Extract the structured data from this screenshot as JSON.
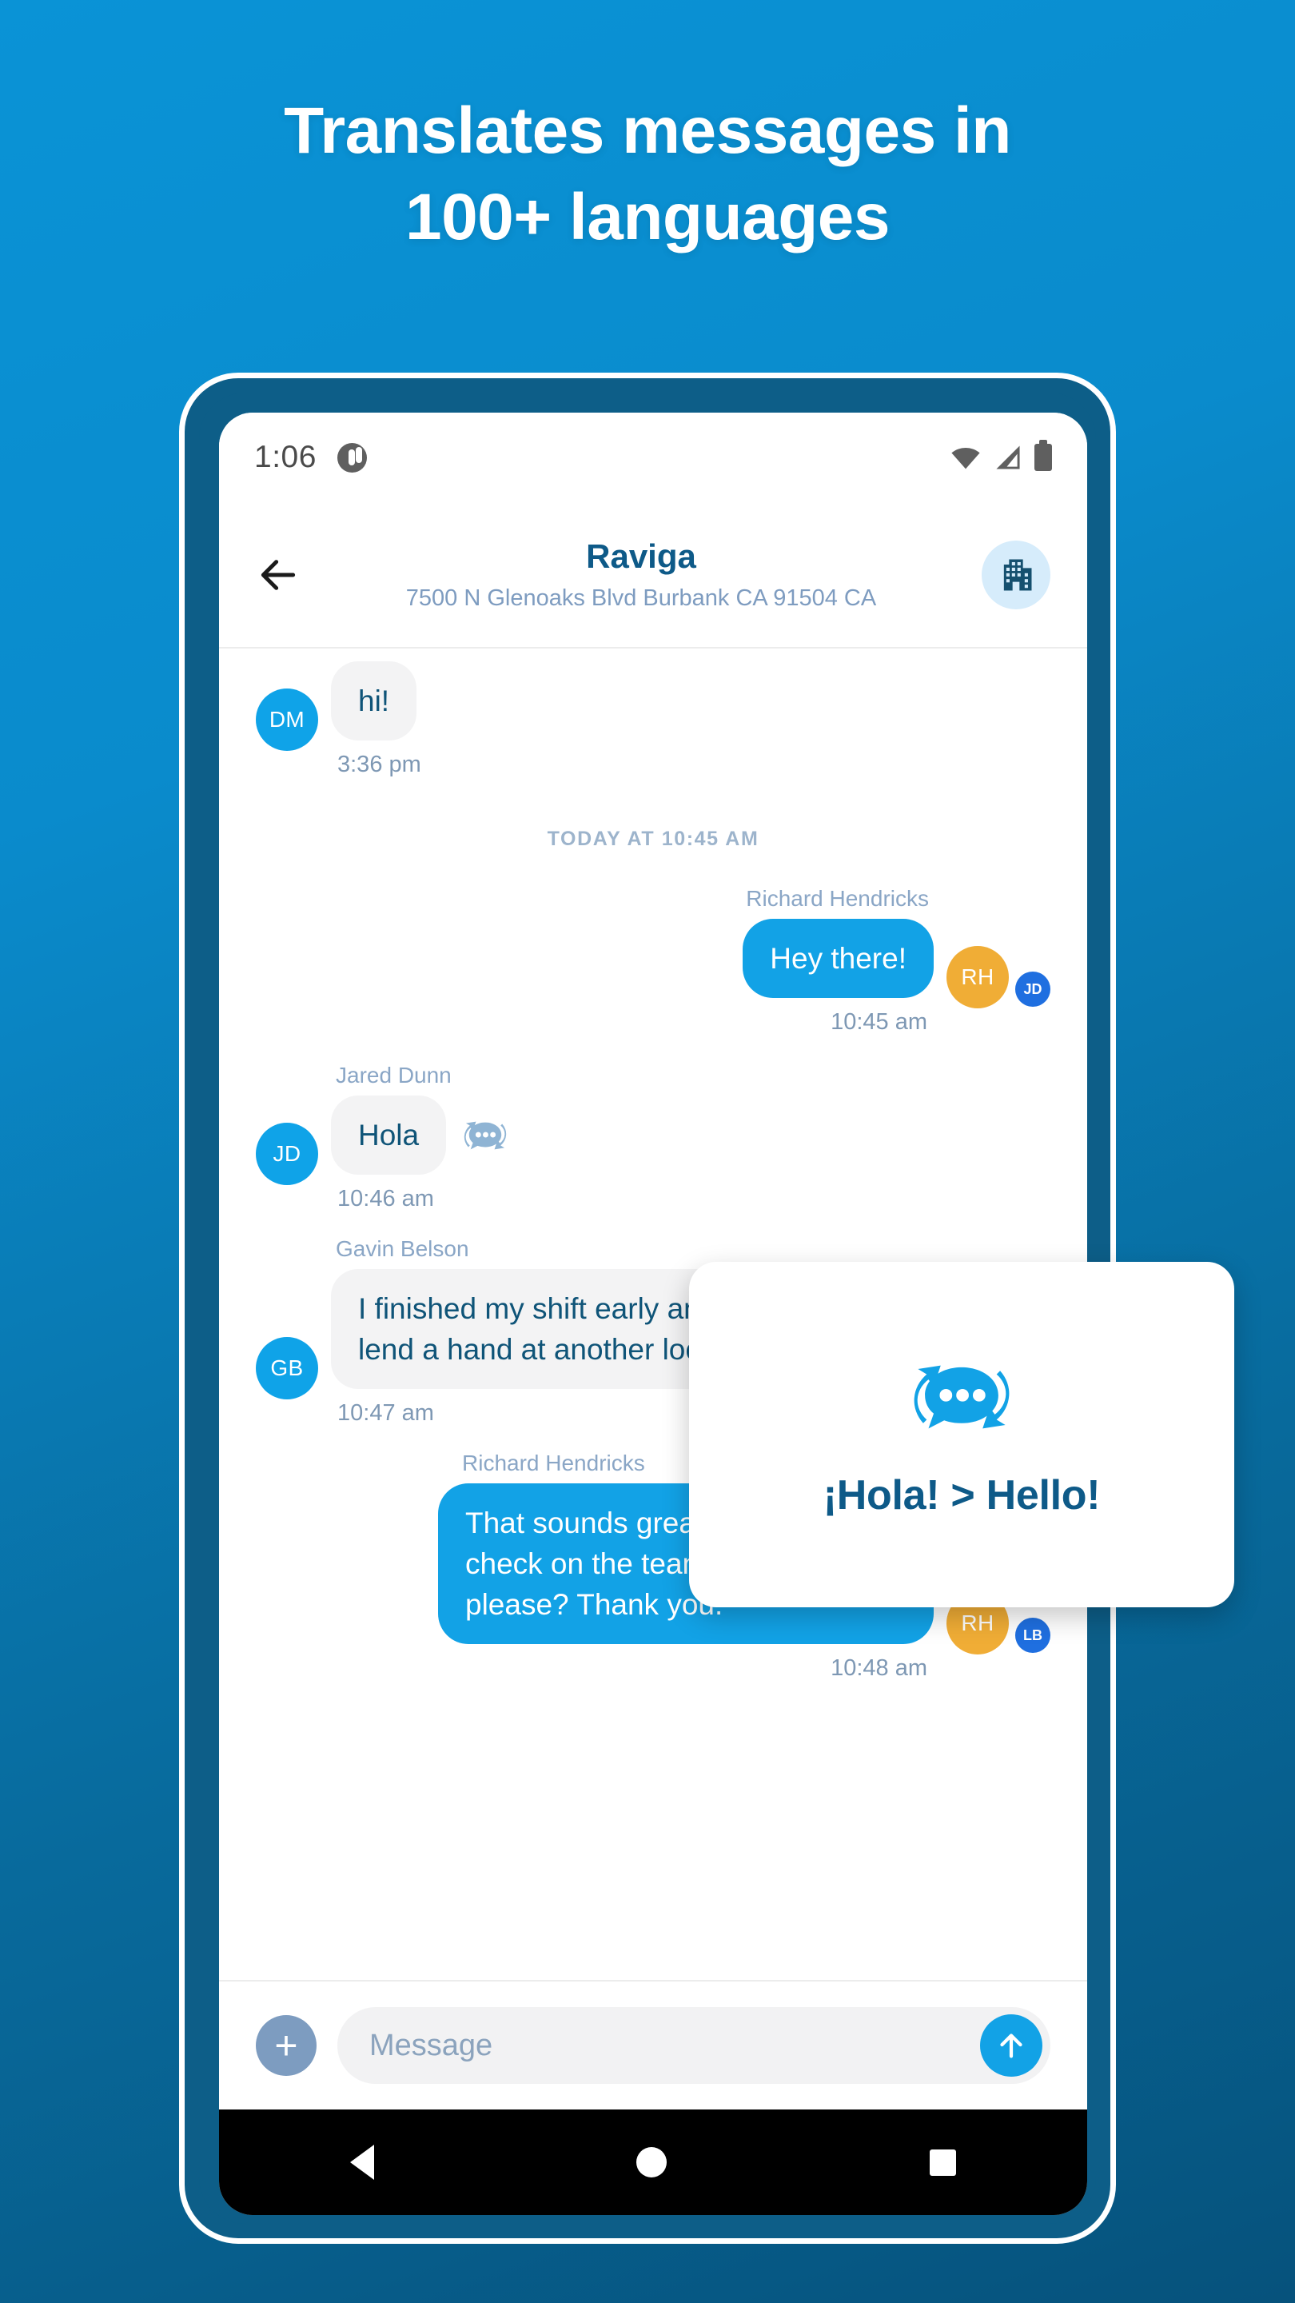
{
  "headline": {
    "line1": "Translates messages in",
    "line2": "100+ languages"
  },
  "colors": {
    "bg_top": "#0a93d6",
    "bg_bottom": "#06527c",
    "accent_blue": "#12a2e6",
    "deep_blue": "#0e5a88",
    "avatar_blue": "#0fa3e8",
    "avatar_orange": "#f0ad36",
    "badge_blue": "#1f6fe0",
    "bubble_in": "#f3f3f4"
  },
  "status_bar": {
    "time": "1:06",
    "notification_icon": "notification-circle-icon",
    "wifi_icon": "wifi-icon",
    "signal_icon": "cell-signal-icon",
    "battery_icon": "battery-full-icon"
  },
  "chat_header": {
    "back_icon": "back-arrow-icon",
    "title": "Raviga",
    "subtitle": "7500 N Glenoaks Blvd Burbank CA 91504 CA",
    "action_icon": "office-building-icon"
  },
  "messages": [
    {
      "side": "left",
      "avatar": "DM",
      "avatar_color": "blue",
      "sender": "",
      "text": "hi!",
      "time": "3:36 pm",
      "translate_icon": false,
      "badge": ""
    },
    {
      "side": "right",
      "avatar": "RH",
      "avatar_color": "orange",
      "sender": "Richard Hendricks",
      "text": "Hey there!",
      "time": "10:45 am",
      "translate_icon": false,
      "badge": "JD"
    },
    {
      "side": "left",
      "avatar": "JD",
      "avatar_color": "blue",
      "sender": "Jared Dunn",
      "text": "Hola",
      "time": "10:46 am",
      "translate_icon": true,
      "badge": ""
    },
    {
      "side": "left",
      "avatar": "GB",
      "avatar_color": "blue",
      "sender": "Gavin Belson",
      "text": "I finished my shift early and can lend a hand at another location",
      "time": "10:47 am",
      "translate_icon": false,
      "badge": ""
    },
    {
      "side": "right",
      "avatar": "RH",
      "avatar_color": "orange",
      "sender": "Richard Hendricks",
      "text": "That sounds great! Can you check on the team at Eklow Labs please? Thank you.",
      "time": "10:48 am",
      "translate_icon": false,
      "badge": "LB"
    }
  ],
  "date_divider": "TODAY AT 10:45 AM",
  "callout": {
    "icon": "translate-bubble-icon",
    "text": "¡Hola! > Hello!"
  },
  "composer": {
    "add_icon": "plus-icon",
    "placeholder": "Message",
    "send_icon": "send-arrow-up-icon"
  },
  "nav_bar": {
    "back": "nav-back-triangle-icon",
    "home": "nav-home-circle-icon",
    "recents": "nav-recents-square-icon"
  }
}
